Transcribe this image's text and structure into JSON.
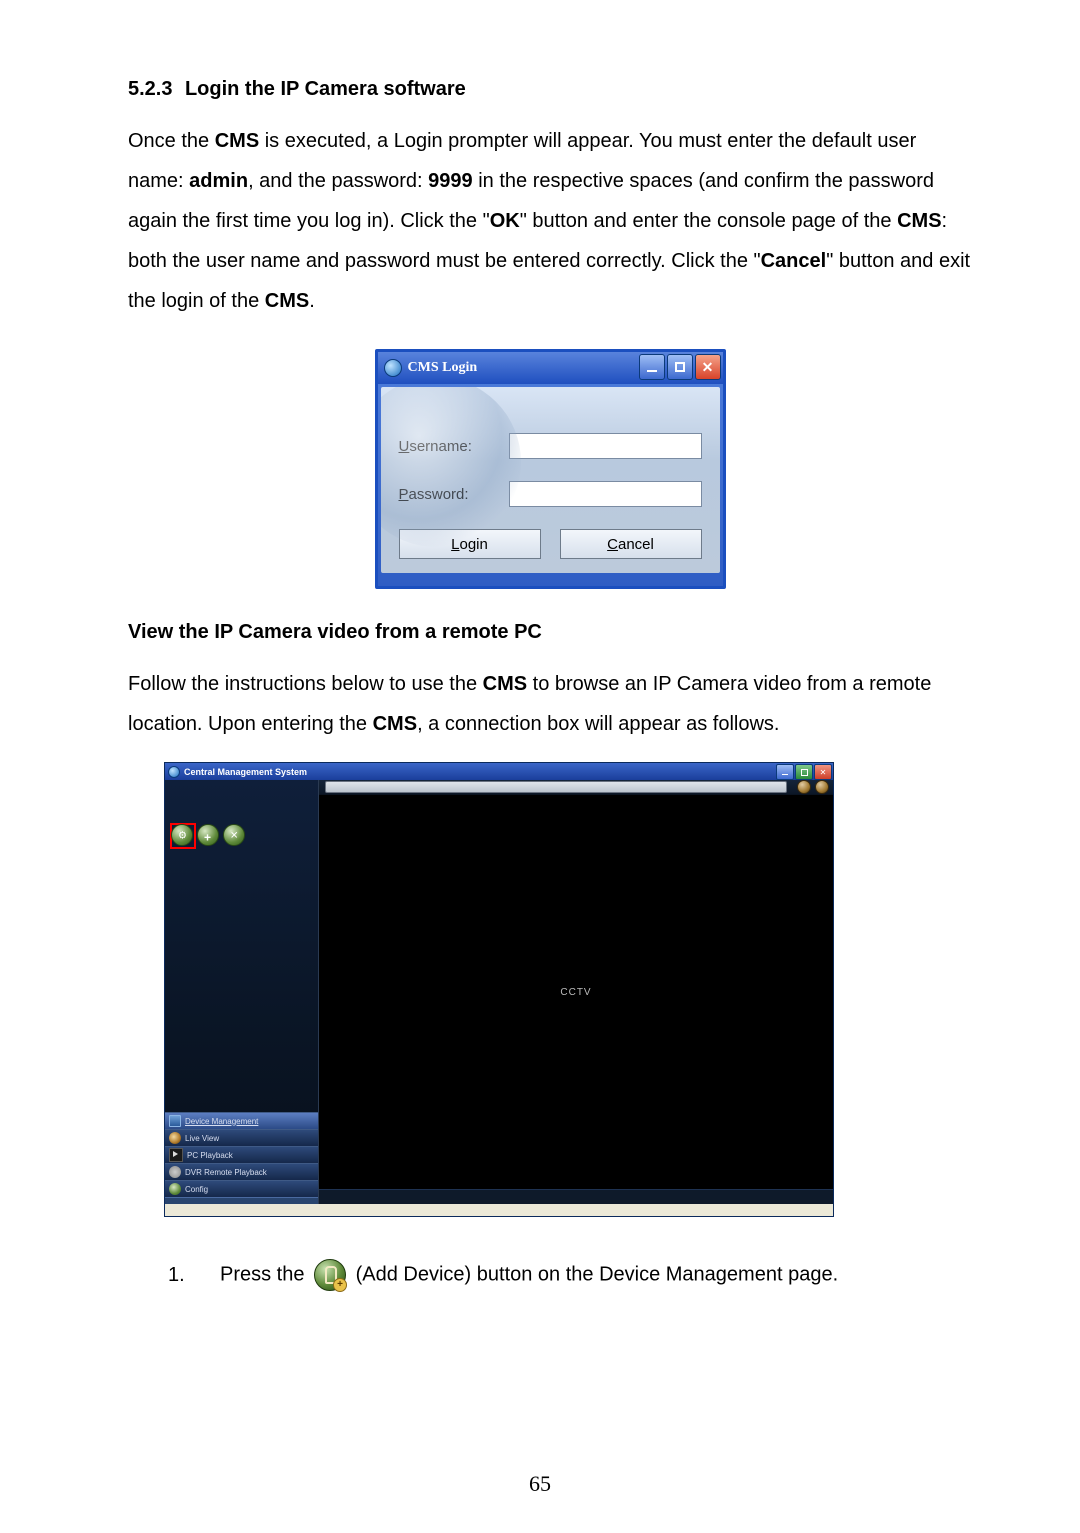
{
  "section": {
    "number": "5.2.3",
    "title": "Login the IP Camera software"
  },
  "paragraph1": {
    "pre": "Once the ",
    "b1": "CMS",
    "t2": " is executed, a Login prompter will appear. You must enter the default user name: ",
    "b2": "admin",
    "t3": ", and the password: ",
    "b3": "9999",
    "t4": " in the respective spaces (and confirm the password again the first time you log in). Click the \"",
    "b4": "OK",
    "t5": "\" button and enter the console page of the ",
    "b5": "CMS",
    "t6": ": both the user name and password must be entered correctly. Click the \"",
    "b6": "Cancel",
    "t7": "\" button and exit the login of the ",
    "b7": "CMS",
    "t8": "."
  },
  "loginWindow": {
    "title": "CMS Login",
    "usernameLabel": {
      "u": "U",
      "rest": "sername:"
    },
    "passwordLabel": {
      "u": "P",
      "rest": "assword:"
    },
    "usernameValue": "",
    "passwordValue": "",
    "loginBtn": {
      "u": "L",
      "rest": "ogin"
    },
    "cancelBtn": {
      "u": "C",
      "rest": "ancel"
    }
  },
  "subhead": "View the IP Camera video from a remote PC",
  "paragraph2": {
    "t1": "Follow the instructions below to use the ",
    "b1": "CMS",
    "t2": " to browse an IP Camera video from a remote location. Upon entering the ",
    "b2": "CMS",
    "t3": ", a connection box will appear as follows."
  },
  "cms": {
    "title": "Central Management System",
    "videoPlaceholder": "CCTV",
    "tabs": [
      {
        "label": "Device Management",
        "selected": true,
        "icon": "ic-screen"
      },
      {
        "label": "Live View",
        "selected": false,
        "icon": "ic-eye"
      },
      {
        "label": "PC Playback",
        "selected": false,
        "icon": "ic-play"
      },
      {
        "label": "DVR Remote Playback",
        "selected": false,
        "icon": "ic-disc"
      },
      {
        "label": "Config",
        "selected": false,
        "icon": "ic-gear"
      }
    ]
  },
  "step": {
    "num": "1.",
    "pre": "Press the ",
    "post": " (Add Device) button on the Device Management page."
  },
  "pageNumber": "65"
}
